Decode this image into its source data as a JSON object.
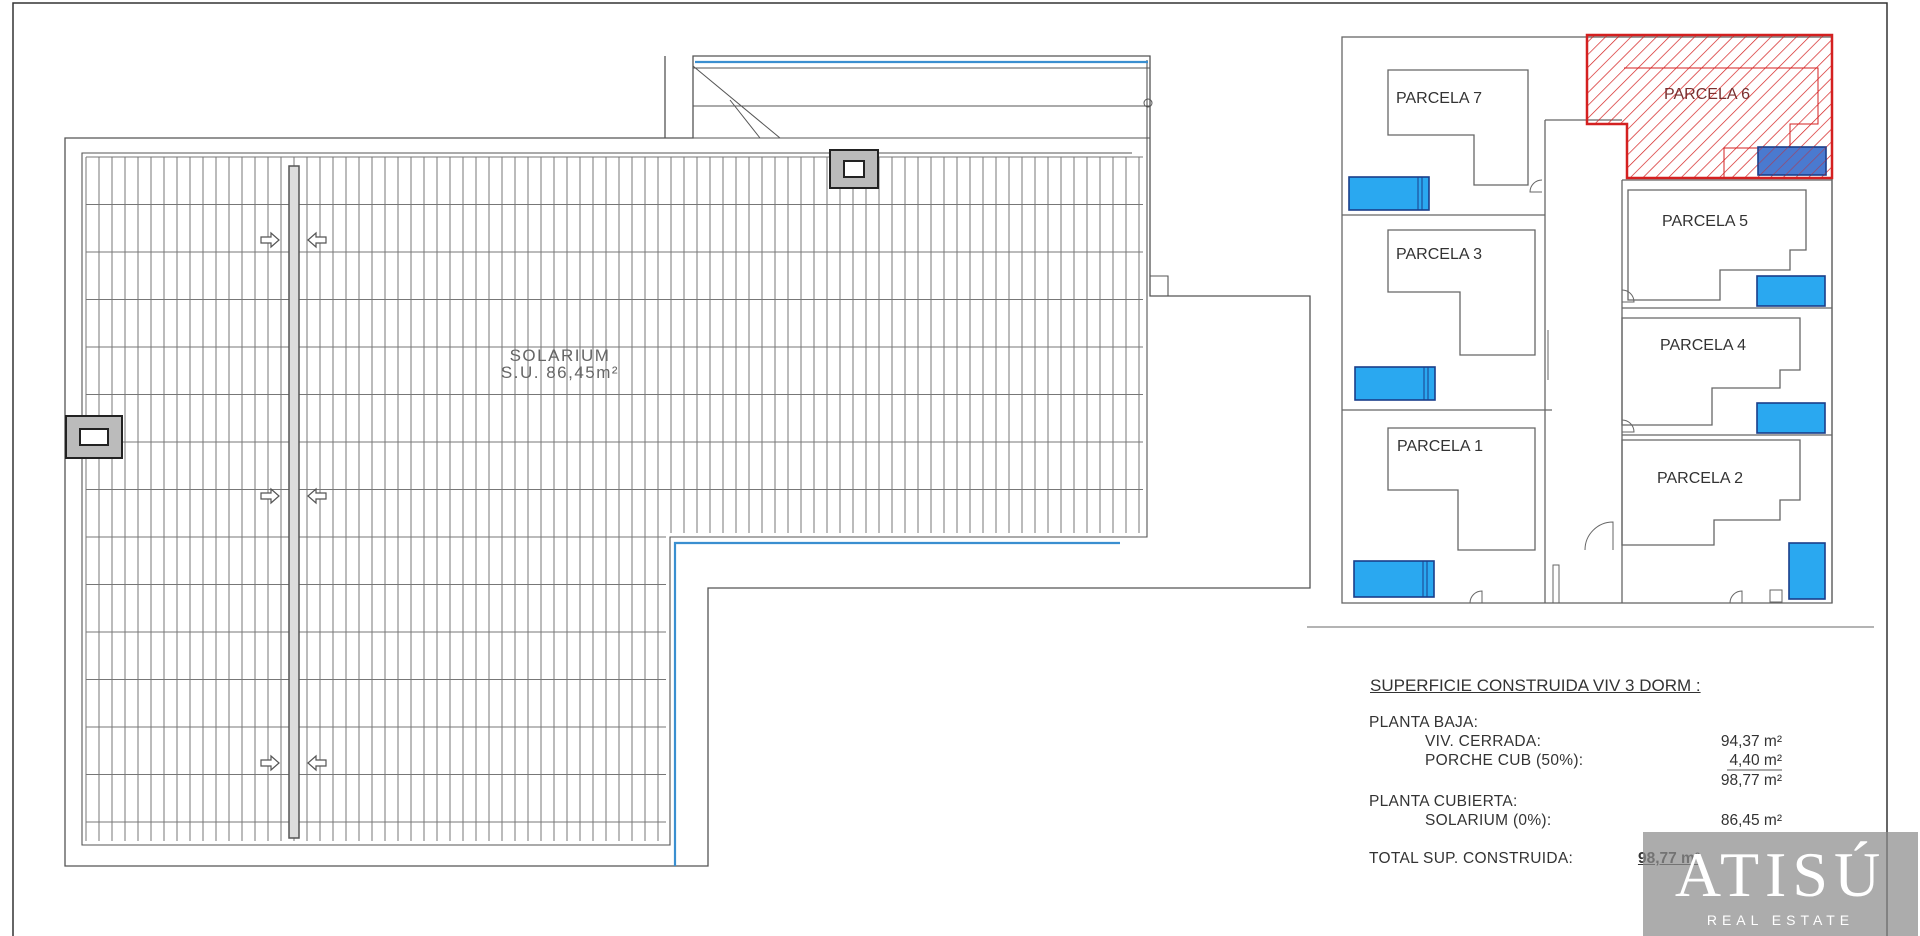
{
  "solarium": {
    "label": "SOLARIUM",
    "area": "S.U. 86,45m²"
  },
  "parcels": [
    {
      "id": "parcela-7",
      "label": "PARCELA 7",
      "highlighted": false
    },
    {
      "id": "parcela-6",
      "label": "PARCELA 6",
      "highlighted": true
    },
    {
      "id": "parcela-5",
      "label": "PARCELA 5",
      "highlighted": false
    },
    {
      "id": "parcela-3",
      "label": "PARCELA 3",
      "highlighted": false
    },
    {
      "id": "parcela-4",
      "label": "PARCELA 4",
      "highlighted": false
    },
    {
      "id": "parcela-1",
      "label": "PARCELA 1",
      "highlighted": false
    },
    {
      "id": "parcela-2",
      "label": "PARCELA 2",
      "highlighted": false
    }
  ],
  "surface_table": {
    "title": "SUPERFICIE CONSTRUIDA VIV 3 DORM :",
    "planta_baja": "PLANTA BAJA:",
    "viv_cerrada_label": "VIV. CERRADA:",
    "viv_cerrada_value": "94,37 m²",
    "porche_label": "PORCHE CUB (50%):",
    "porche_value": "4,40 m²",
    "subtotal_value": "98,77 m²",
    "planta_cubierta": "PLANTA CUBIERTA:",
    "solarium_label": "SOLARIUM (0%):",
    "solarium_value": "86,45 m²",
    "total_label": "TOTAL SUP. CONSTRUIDA:",
    "total_value": "98,77 m²"
  },
  "watermark": {
    "logo": "ATISÚ",
    "subtitle": "REAL ESTATE"
  },
  "colors": {
    "pool": "#2aa8f0",
    "highlight": "#d42020",
    "line": "#555555",
    "tile": "#777777"
  }
}
